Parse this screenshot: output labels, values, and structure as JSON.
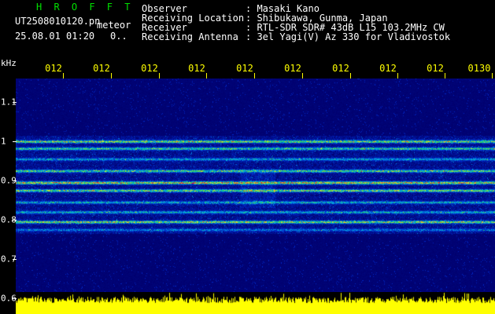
{
  "header": {
    "brand": "H R O F F T",
    "file_name": "UT2508010120.pn",
    "meteor_label": "meteor",
    "date_time": "25.08.01 01:20",
    "count": "0.."
  },
  "meta": [
    {
      "key": "Observer",
      "value": ": Masaki Kano"
    },
    {
      "key": "Receiving Location",
      "value": ": Shibukawa, Gunma, Japan"
    },
    {
      "key": "Receiver",
      "value": ": RTL-SDR SDR# 43dB L15 103.2MHz CW"
    },
    {
      "key": "Receiving Antenna",
      "value": ": 3el Yagi(V) Az 330 for Vladivostok"
    }
  ],
  "freq_axis": {
    "unit": "kHz",
    "ticks": [
      "1.1",
      "1",
      "0.9",
      "0.8",
      "0.7",
      "0.6"
    ]
  },
  "time_axis": {
    "ticks": [
      "012",
      "012",
      "012",
      "012",
      "012",
      "012",
      "012",
      "012",
      "012",
      "0130"
    ]
  },
  "colors": {
    "brand": "#00e000",
    "axis_time": "#ffff00",
    "background": "#000000",
    "spectrum_floor": "#00007a",
    "power_trace": "#ffff00"
  },
  "chart_data": {
    "type": "heatmap",
    "xlabel": "",
    "ylabel": "kHz",
    "ylim": [
      0.6,
      1.15
    ],
    "y_ticks": [
      1.1,
      1.0,
      0.9,
      0.8,
      0.7,
      0.6
    ],
    "bands_khz": [
      {
        "center": 1.0,
        "strength": 0.85
      },
      {
        "center": 0.982,
        "strength": 0.7
      },
      {
        "center": 0.955,
        "strength": 0.5
      },
      {
        "center": 0.925,
        "strength": 0.75
      },
      {
        "center": 0.895,
        "strength": 1.0
      },
      {
        "center": 0.875,
        "strength": 0.8
      },
      {
        "center": 0.845,
        "strength": 0.55
      },
      {
        "center": 0.82,
        "strength": 0.55
      },
      {
        "center": 0.795,
        "strength": 0.85
      },
      {
        "center": 0.775,
        "strength": 0.4
      }
    ]
  }
}
